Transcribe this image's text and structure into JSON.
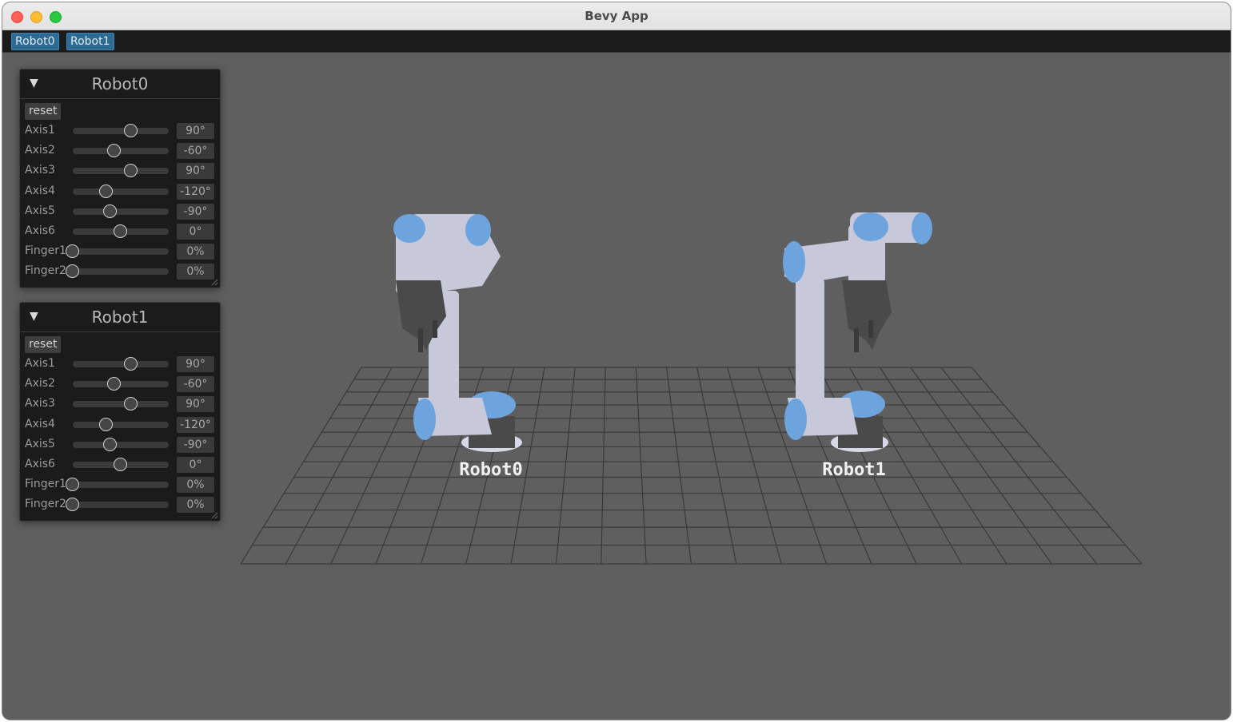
{
  "window": {
    "title": "Bevy App"
  },
  "menubar": {
    "buttons": [
      "Robot0",
      "Robot1"
    ]
  },
  "scene": {
    "labels": [
      "Robot0",
      "Robot1"
    ]
  },
  "panels": [
    {
      "title": "Robot0",
      "reset_label": "reset",
      "rows": [
        {
          "label": "Axis1",
          "value": "90°",
          "level": 0.61
        },
        {
          "label": "Axis2",
          "value": "-60°",
          "level": 0.43
        },
        {
          "label": "Axis3",
          "value": "90°",
          "level": 0.61
        },
        {
          "label": "Axis4",
          "value": "-120°",
          "level": 0.35
        },
        {
          "label": "Axis5",
          "value": "-90°",
          "level": 0.39
        },
        {
          "label": "Axis6",
          "value": "0°",
          "level": 0.5
        },
        {
          "label": "Finger1",
          "value": "0%",
          "level": 0.0
        },
        {
          "label": "Finger2",
          "value": "0%",
          "level": 0.0
        }
      ]
    },
    {
      "title": "Robot1",
      "reset_label": "reset",
      "rows": [
        {
          "label": "Axis1",
          "value": "90°",
          "level": 0.61
        },
        {
          "label": "Axis2",
          "value": "-60°",
          "level": 0.43
        },
        {
          "label": "Axis3",
          "value": "90°",
          "level": 0.61
        },
        {
          "label": "Axis4",
          "value": "-120°",
          "level": 0.35
        },
        {
          "label": "Axis5",
          "value": "-90°",
          "level": 0.39
        },
        {
          "label": "Axis6",
          "value": "0°",
          "level": 0.5
        },
        {
          "label": "Finger1",
          "value": "0%",
          "level": 0.0
        },
        {
          "label": "Finger2",
          "value": "0%",
          "level": 0.0
        }
      ]
    }
  ],
  "colors": {
    "viewport_bg": "#5f5f5f",
    "robot_body": "#c7c9da",
    "robot_joint": "#6ea4de",
    "gripper": "#4a4a4a",
    "grid": "#3a3a3a",
    "menu_accent": "#2d6b94"
  }
}
